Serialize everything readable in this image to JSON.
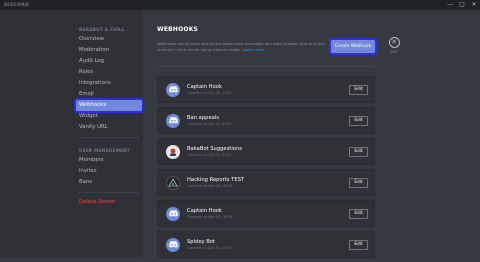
{
  "window": {
    "title": "DISCORD",
    "controls": [
      "—",
      "□",
      "✕"
    ]
  },
  "sidebar": {
    "sections": [
      {
        "header": "BAKABOT & CHILL",
        "items": [
          {
            "label": "Overview",
            "active": false
          },
          {
            "label": "Moderation",
            "active": false
          },
          {
            "label": "Audit Log",
            "active": false
          },
          {
            "label": "Roles",
            "active": false
          },
          {
            "label": "Integrations",
            "active": false
          },
          {
            "label": "Emoji",
            "active": false
          },
          {
            "label": "Webhooks",
            "active": true
          },
          {
            "label": "Widget",
            "active": false
          },
          {
            "label": "Vanity URL",
            "active": false
          }
        ]
      },
      {
        "header": "USER MANAGEMENT",
        "items": [
          {
            "label": "Members",
            "active": false
          },
          {
            "label": "Invites",
            "active": false
          },
          {
            "label": "Bans",
            "active": false
          }
        ]
      }
    ],
    "delete_label": "Delete Server"
  },
  "main": {
    "title": "WEBHOOKS",
    "description": "Webhooks are an easy way to get automated messages and data updates sent to a text channel in your server using internet magic.",
    "learn_more": "Learn more.",
    "create_button": "Create Webhook",
    "close": {
      "icon": "close-icon",
      "glyph": "✕",
      "label": "ESC"
    },
    "edit_label": "Edit",
    "webhooks": [
      {
        "name": "Captain Hook",
        "date": "Created on Oct 18, 2018",
        "avatar": "discord-logo",
        "avatar_color": "#7289da"
      },
      {
        "name": "Ban appeals",
        "date": "Created on Oct 19, 2018",
        "avatar": "discord-logo",
        "avatar_color": "#7289da"
      },
      {
        "name": "BakaBot Suggestions",
        "date": "Created on Oct 22, 2018",
        "avatar": "custom-image",
        "avatar_color": "#e8e8e8"
      },
      {
        "name": "Hacking Reports TEST",
        "date": "Created on Nov 30, 2018",
        "avatar": "custom-image",
        "avatar_color": "#202225"
      },
      {
        "name": "Captain Hook",
        "date": "Created on Nov 30, 2018",
        "avatar": "discord-logo",
        "avatar_color": "#7289da"
      },
      {
        "name": "Spidey Bot",
        "date": "Created on Apr 30, 2019",
        "avatar": "discord-logo",
        "avatar_color": "#7289da"
      }
    ]
  },
  "colors": {
    "accent": "#7289da",
    "highlight": "#2c2ee0",
    "danger": "#f04747"
  }
}
